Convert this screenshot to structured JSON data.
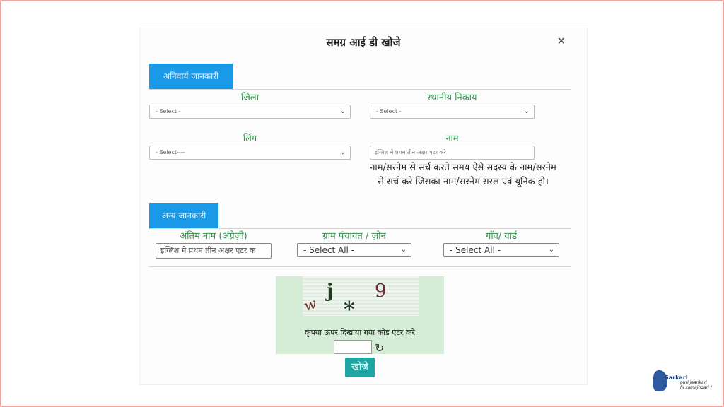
{
  "dialog": {
    "title": "समग्र आई डी खोजे",
    "close_label": "×"
  },
  "sections": {
    "mandatory": "अनिवार्य जानकारी",
    "other": "अन्य जानकारी"
  },
  "fields": {
    "district": {
      "label": "जिला",
      "value": "- Select -"
    },
    "local_body": {
      "label": "स्थानीय निकाय",
      "value": "- Select -"
    },
    "gender": {
      "label": "लिंग",
      "value": "- Select----"
    },
    "name": {
      "label": "नाम",
      "placeholder": "इंग्लिश मे प्रथम तीन अक्षर एंटर करे"
    },
    "name_note": "नाम/सरनेम से सर्च करते समय ऐसे सदस्य के नाम/सरनेम से सर्च करे जिसका नाम/सरनेम सरल एवं यूनिक हो।",
    "surname": {
      "label": "अंतिम नाम (अंग्रेज़ी)",
      "placeholder": "इंग्लिश मे प्रथम तीन अक्षर एंटर क"
    },
    "gram_panchayat": {
      "label": "ग्राम पंचायत / ज़ोन",
      "value": "- Select All -"
    },
    "village_ward": {
      "label": "गाँव/ वार्ड",
      "value": "- Select All -"
    }
  },
  "captcha": {
    "chars": [
      "w",
      "j",
      "*",
      "9"
    ],
    "help_text": "कृपया ऊपर दिखाया गया कोड एंटर करे",
    "input_value": ""
  },
  "search_button": "खोजे",
  "logo": {
    "name": "Sarkari",
    "tagline_1": "puri jaankari",
    "tagline_2": "hi samajhdari !"
  }
}
